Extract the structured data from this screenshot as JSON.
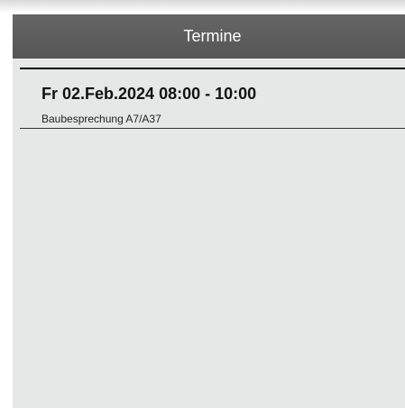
{
  "panel": {
    "title": "Termine"
  },
  "appointments": [
    {
      "datetime": "Fr 02.Feb.2024 08:00 - 10:00",
      "title": "Baubesprechung A7/A37"
    }
  ]
}
